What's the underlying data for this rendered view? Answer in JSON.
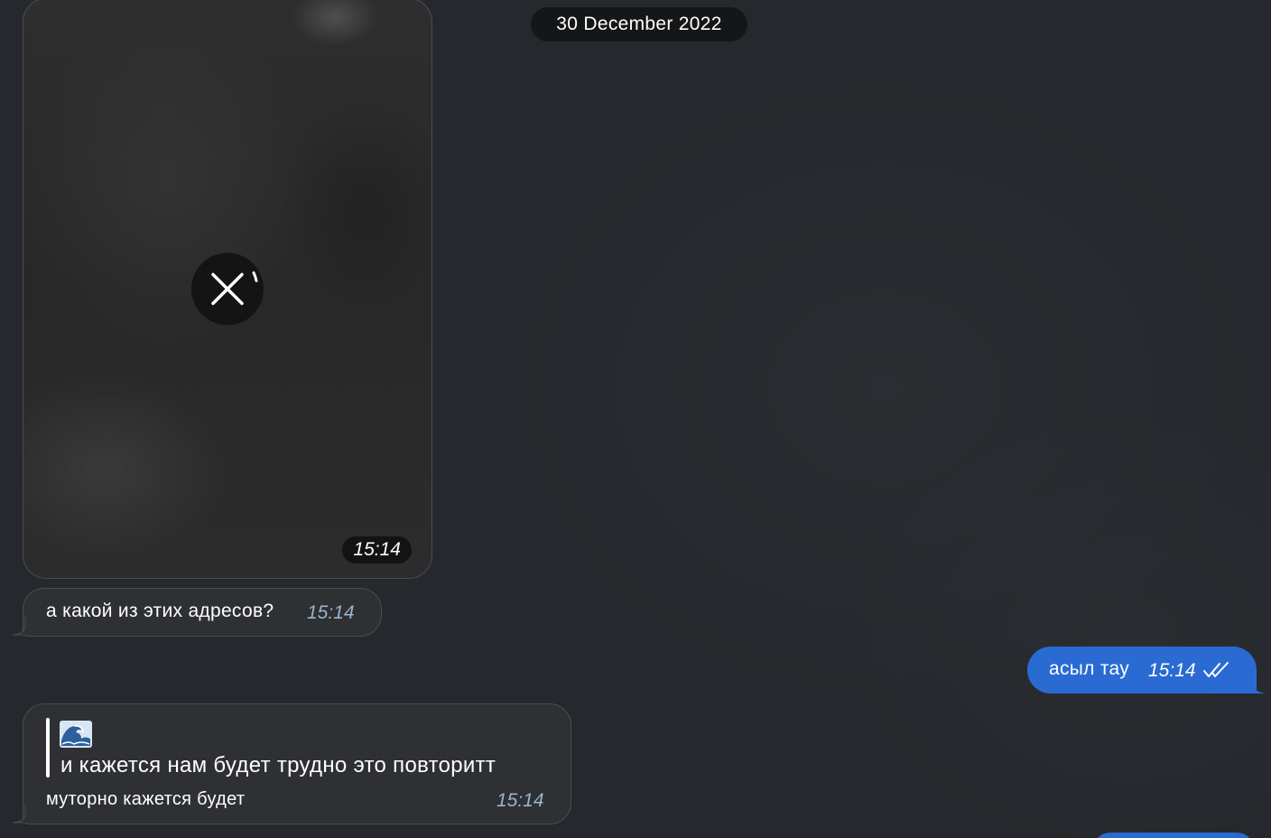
{
  "date_separator": "30 December 2022",
  "media_message": {
    "time": "15:14",
    "status_icon": "cancel-download-icon"
  },
  "messages": [
    {
      "direction": "incoming",
      "text": "а какой из этих адресов?",
      "time": "15:14"
    },
    {
      "direction": "outgoing",
      "text": "асыл тау",
      "time": "15:14",
      "status_icon": "double-check-icon"
    },
    {
      "direction": "incoming",
      "quote_emoji_icon": "water-wave-icon",
      "quote_text": "и кажется нам будет трудно это повторитт",
      "text": "муторно кажется будет",
      "time": "15:14"
    }
  ],
  "colors": {
    "background": "#25282c",
    "incoming_bubble": "#2e3033",
    "outgoing_bubble": "#2a6bd3",
    "incoming_time": "#9ab4cf"
  }
}
